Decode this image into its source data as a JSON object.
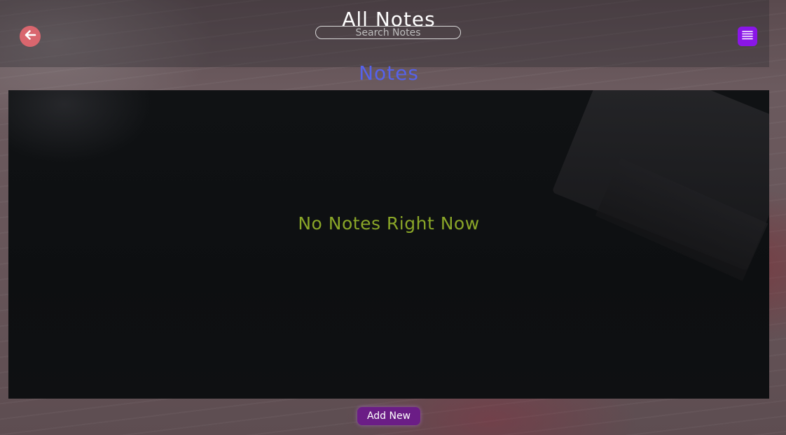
{
  "header": {
    "title": "All Notes",
    "search_placeholder": "Search Notes"
  },
  "icons": {
    "back": "arrow-left-icon",
    "menu": "list-icon"
  },
  "main": {
    "section_title": "Notes",
    "empty_message": "No Notes Right Now",
    "add_button_label": "Add New"
  },
  "colors": {
    "title": "#ffffff",
    "section_title": "#5662ea",
    "empty_message": "#8aa628",
    "back_button": "#d9666e",
    "menu_button": "#8a16e8",
    "add_button": "#6b1d86"
  }
}
